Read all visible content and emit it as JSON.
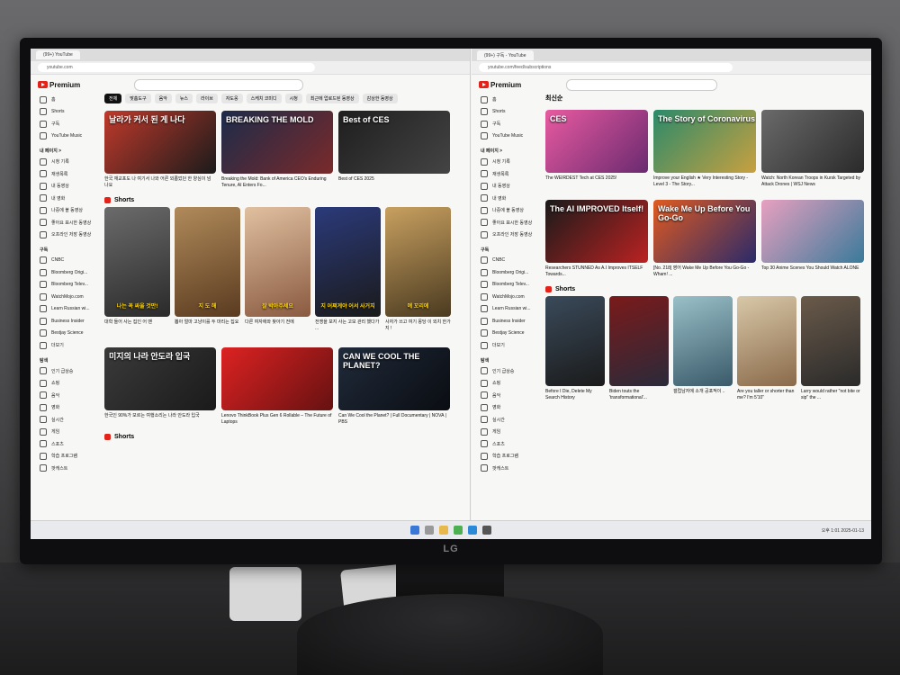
{
  "monitor_brand": "LG",
  "left_window": {
    "tab_title": "(99+) YouTube",
    "url": "youtube.com",
    "logo_text": "Premium",
    "search_placeholder": "",
    "chips": [
      "전체",
      "맞춤도구",
      "음악",
      "뉴스",
      "라이브",
      "자도웅",
      "스케치 코미디",
      "시청",
      "최근에 업로드된 동영상",
      "감상한 동영상"
    ],
    "sidebar": {
      "top": [
        "홈",
        "Shorts",
        "구독",
        "YouTube Music"
      ],
      "you_heading": "내 페이지 >",
      "you": [
        "시청 기록",
        "재생목록",
        "내 동영상",
        "내 영화",
        "나중에 볼 동영상",
        "좋아요 표시한 동영상",
        "오프라인 저장 동영상"
      ],
      "subs_heading": "구독",
      "subs": [
        "CNBC",
        "Bloomberg Origi...",
        "Bloomberg Telev...",
        "WatchMojo.com",
        "Learn Russian wi...",
        "Business Insider",
        "Bestjay Science",
        "더보기"
      ],
      "explore_heading": "탐색",
      "explore": [
        "인기 급상승",
        "쇼핑",
        "음악",
        "영화",
        "실시간",
        "게임",
        "스포츠",
        "학습 프로그램",
        "팟캐스트"
      ]
    },
    "videos_row1": [
      {
        "thumb_text": "날라가 커서 된 게 나다",
        "title": "한국 재교포도 나 여기서 나와 어른 외롭었던 한 양심이 넘 나요",
        "color1": "#c0392b",
        "color2": "#1b1b1b"
      },
      {
        "thumb_text": "BREAKING THE MOLD",
        "title": "Breaking the Mold: Bank of America CEO's Enduring Tenure, AI Enters Fo...",
        "color1": "#1c2b4a",
        "color2": "#7a2a2a"
      },
      {
        "thumb_text": "Best of CES",
        "title": "Best of CES 2025",
        "color1": "#1e1e1e",
        "color2": "#444"
      }
    ],
    "shorts_heading": "Shorts",
    "shorts": [
      {
        "text": "나는 꼭 싸울 것만!",
        "title": "대학 들어 사는 집인 어 땐",
        "color1": "#6b6b6b",
        "color2": "#2a2a2a"
      },
      {
        "text": "지 도 해",
        "title": "뽑아 얼마 고냥이를 두 마리는 집요",
        "color1": "#b08a5a",
        "color2": "#5a3b20"
      },
      {
        "text": "잘 박아주세요",
        "title": "다른 여자애와 찾아기 전에",
        "color1": "#e0c0a0",
        "color2": "#8a5a40"
      },
      {
        "text": "지 어쩌게야 어서 사거지",
        "title": "전쟁을 보지 사는 고모 관리 했다가 ...",
        "color1": "#2b3a7a",
        "color2": "#1a1a1a"
      },
      {
        "text": "예 꼬리에",
        "title": "사자가 쓰고 여기 몽당 이 외치 한가지 !",
        "color1": "#c8a060",
        "color2": "#4a3a20"
      }
    ],
    "videos_row2": [
      {
        "thumb_text": "미지의 나라 안도라 입국",
        "title": "한국인 90%가 모르는 여행소리는 나라 안도라 입국",
        "color1": "#3a3a3a",
        "color2": "#1a1a1a"
      },
      {
        "thumb_text": "",
        "title": "Lenovo ThinkBook Plus Gen 6 Rollable – The Future of Laptops",
        "color1": "#d22",
        "color2": "#611"
      },
      {
        "thumb_text": "CAN WE COOL THE PLANET?",
        "title": "Can We Cool the Planet? | Full Documentary | NOVA | PBS",
        "color1": "#202a3a",
        "color2": "#0a0d12"
      }
    ],
    "shorts_heading_2": "Shorts"
  },
  "right_window": {
    "tab_title": "(99+) 구독 - YouTube",
    "url": "youtube.com/feed/subscriptions",
    "logo_text": "Premium",
    "section_title": "최신순",
    "sidebar": {
      "top": [
        "홈",
        "Shorts",
        "구독",
        "YouTube Music"
      ],
      "you_heading": "내 페이지 >",
      "you": [
        "시청 기록",
        "재생목록",
        "내 동영상",
        "내 영화",
        "나중에 볼 동영상",
        "좋아요 표시한 동영상",
        "오프라인 저장 동영상"
      ],
      "subs_heading": "구독",
      "subs": [
        "CNBC",
        "Bloomberg Origi...",
        "Bloomberg Telev...",
        "WatchMojo.com",
        "Learn Russian wi...",
        "Business Insider",
        "Bestjay Science",
        "더보기"
      ],
      "explore_heading": "탐색",
      "explore": [
        "인기 급상승",
        "쇼핑",
        "음악",
        "영화",
        "실시간",
        "게임",
        "스포츠",
        "학습 프로그램",
        "팟캐스트"
      ]
    },
    "videos_row1": [
      {
        "thumb_text": "CES",
        "title": "The WEIRDEST Tech at CES 2025!",
        "color1": "#e85aa0",
        "color2": "#6a2a70"
      },
      {
        "thumb_text": "The Story of Coronavirus",
        "title": "Improve your English ★ Very Interesting Story - Level 3 - The Story...",
        "color1": "#2a8a6a",
        "color2": "#c8a040"
      },
      {
        "thumb_text": "",
        "title": "Watch: North Korean Troops in Kursk Targeted by Attack Drones | WSJ News",
        "color1": "#6a6a6a",
        "color2": "#2a2a2a"
      }
    ],
    "videos_row2": [
      {
        "thumb_text": "The AI IMPROVED Itself!",
        "title": "Researchers STUNNED As A.I Improves ITSELF Towards...",
        "color1": "#1a1a1a",
        "color2": "#b22"
      },
      {
        "thumb_text": "Wake Me Up Before You Go-Go",
        "title": "[No. 218] 영어 Wake Me Up Before You Go-Go - Wham! ...",
        "color1": "#e05a20",
        "color2": "#2a2a6a"
      },
      {
        "thumb_text": "",
        "title": "Top 30 Anime Scenes You Should Watch ALONE",
        "color1": "#e8a0c0",
        "color2": "#3a7a9a"
      }
    ],
    "shorts_heading": "Shorts",
    "shorts": [
      {
        "text": "",
        "title": "Before I Die, Delete My Search History",
        "color1": "#3a4a5a",
        "color2": "#1a1a1a"
      },
      {
        "text": "",
        "title": "Biden touts the 'transformational'...",
        "color1": "#7a1a1a",
        "color2": "#2a2a3a"
      },
      {
        "text": "",
        "title": "갤럽남자에 소개 공포적이 ..",
        "color1": "#9ac0c8",
        "color2": "#3a5a6a"
      },
      {
        "text": "",
        "title": "Are you taller or shorter than me? I'm 5'10\"",
        "color1": "#d8c8a8",
        "color2": "#8a6a4a"
      },
      {
        "text": "",
        "title": "Larry would rather \"not bite or sip\" the ...",
        "color1": "#6a5a4a",
        "color2": "#2a2a2a"
      }
    ]
  },
  "taskbar": {
    "time": "오후 1:01",
    "date": "2025-01-13"
  }
}
